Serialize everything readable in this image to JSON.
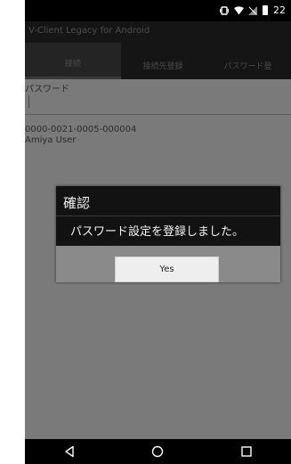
{
  "status_bar": {
    "clock": "22",
    "icons": [
      "vibrate-icon",
      "wifi-icon",
      "signal-icon",
      "battery-icon"
    ]
  },
  "app": {
    "title": "V-Client Legacy for Android"
  },
  "tabs": [
    {
      "label": "接続",
      "selected": true
    },
    {
      "label": "接続先登録",
      "selected": false
    },
    {
      "label": "パスワード登",
      "selected": false
    }
  ],
  "form": {
    "password_label": "パスワード",
    "password_value": "",
    "device_id": "0000-0021-0005-000004",
    "user_name": "Amiya User"
  },
  "dialog": {
    "title": "確認",
    "message": "パスワード設定を登録しました。",
    "yes_label": "Yes"
  },
  "nav": {
    "icons": [
      "back-icon",
      "home-icon",
      "recents-icon"
    ]
  },
  "colors": {
    "overlay_gray": "#7a7a7a",
    "dialog_bg": "#121212",
    "button_bg": "#eeeeee"
  }
}
